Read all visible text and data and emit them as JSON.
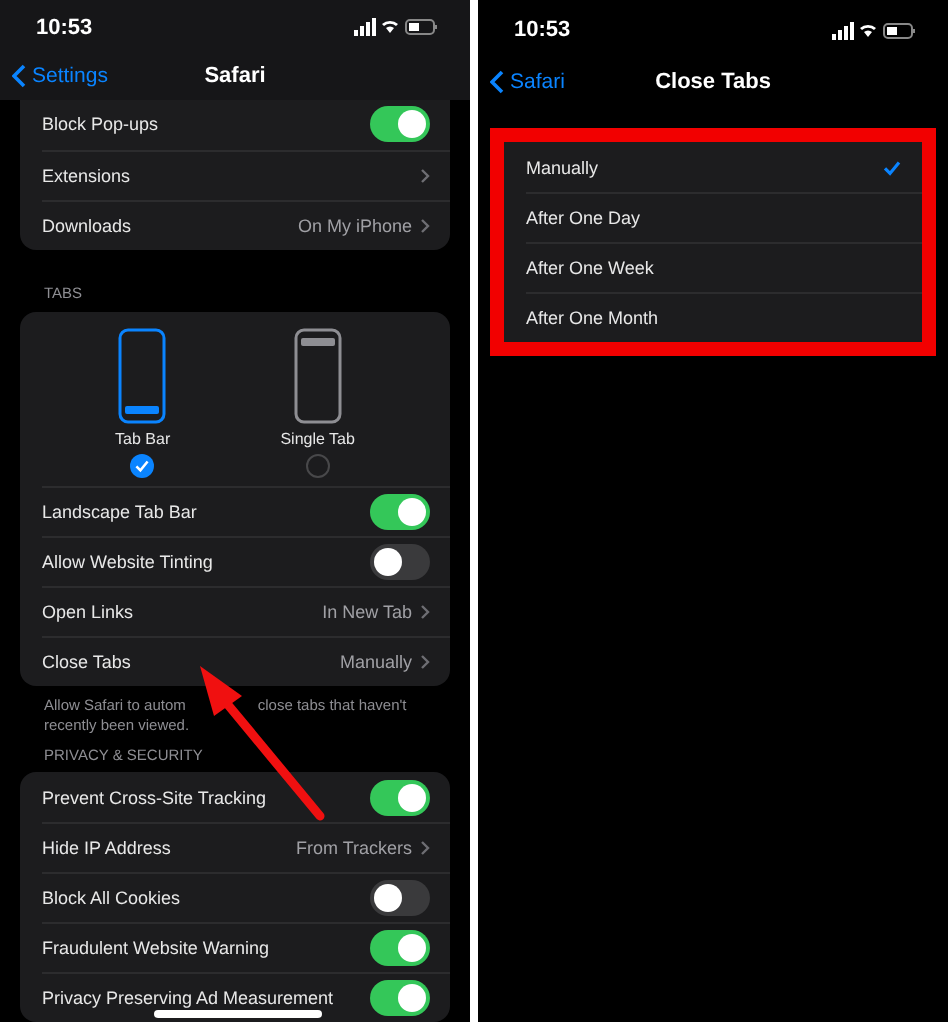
{
  "settings_screen": {
    "status_bar": {
      "time": "10:53"
    },
    "nav": {
      "back": "Settings",
      "title": "Safari"
    },
    "top_group": [
      {
        "kind": "toggle",
        "label": "Block Pop-ups",
        "on": true
      },
      {
        "kind": "link",
        "label": "Extensions"
      },
      {
        "kind": "link",
        "label": "Downloads",
        "value": "On My iPhone"
      }
    ],
    "tabs_header": "TABS",
    "tab_layouts": [
      {
        "label": "Tab Bar",
        "selected": true
      },
      {
        "label": "Single Tab",
        "selected": false
      }
    ],
    "tabs_group": [
      {
        "kind": "toggle",
        "label": "Landscape Tab Bar",
        "on": true
      },
      {
        "kind": "toggle",
        "label": "Allow Website Tinting",
        "on": false
      },
      {
        "kind": "link",
        "label": "Open Links",
        "value": "In New Tab"
      },
      {
        "kind": "link",
        "label": "Close Tabs",
        "value": "Manually"
      }
    ],
    "footnote": [
      "Allow Safari to autom",
      "close tabs that haven't",
      "recently been viewed."
    ],
    "privacy_header": "PRIVACY & SECURITY",
    "privacy_group": [
      {
        "kind": "toggle",
        "label": "Prevent Cross-Site Tracking",
        "on": true
      },
      {
        "kind": "link",
        "label": "Hide IP Address",
        "value": "From Trackers"
      },
      {
        "kind": "toggle",
        "label": "Block All Cookies",
        "on": false
      },
      {
        "kind": "toggle",
        "label": "Fraudulent Website Warning",
        "on": true
      },
      {
        "kind": "toggle",
        "label": "Privacy Preserving Ad Measurement",
        "on": true
      }
    ]
  },
  "close_tabs_screen": {
    "status_bar": {
      "time": "10:53"
    },
    "nav": {
      "back": "Safari",
      "title": "Close Tabs"
    },
    "options": [
      {
        "label": "Manually",
        "selected": true
      },
      {
        "label": "After One Day",
        "selected": false
      },
      {
        "label": "After One Week",
        "selected": false
      },
      {
        "label": "After One Month",
        "selected": false
      }
    ]
  }
}
